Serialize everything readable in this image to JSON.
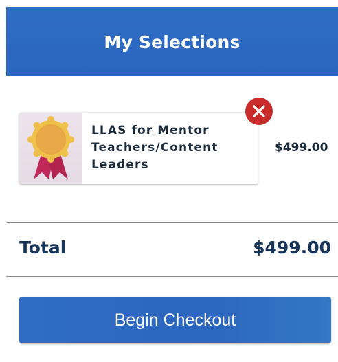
{
  "header": {
    "title": "My Selections",
    "background_color": "#2f6cc4"
  },
  "cart": {
    "items": [
      {
        "name": "LLAS for Mentor Teachers/Content Leaders",
        "price": "$499.00",
        "icon": "award-ribbon-icon",
        "remove_icon": "close-icon"
      }
    ]
  },
  "summary": {
    "total_label": "Total",
    "total_value": "$499.00"
  },
  "actions": {
    "checkout_label": "Begin Checkout"
  },
  "colors": {
    "accent": "#2f6cc4",
    "remove": "#c92b2b",
    "text_dark": "#16335a"
  }
}
